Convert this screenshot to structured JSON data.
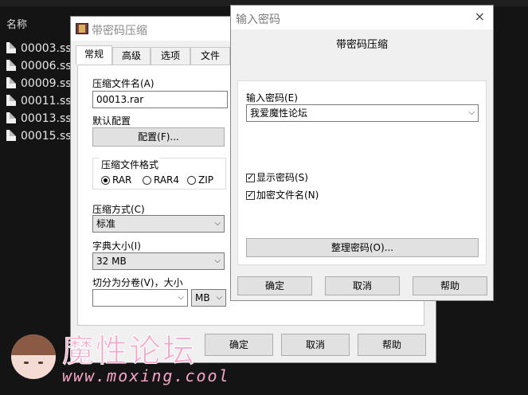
{
  "explorer": {
    "column_header": "名称",
    "files": [
      "00003.ss",
      "00006.ss",
      "00009.ss",
      "00011.ss",
      "00013.ss",
      "00015.ss"
    ]
  },
  "archive_dialog": {
    "title": "带密码压缩",
    "tabs": [
      "常规",
      "高级",
      "选项",
      "文件"
    ],
    "active_tab": "常规",
    "archive_name_label": "压缩文件名(A)",
    "archive_name_value": "00013.rar",
    "default_profile_label": "默认配置",
    "profiles_button": "配置(F)...",
    "format_group_label": "压缩文件格式",
    "formats": [
      "RAR",
      "RAR4",
      "ZIP"
    ],
    "selected_format": "RAR",
    "method_label": "压缩方式(C)",
    "method_value": "标准",
    "dict_label": "字典大小(I)",
    "dict_value": "32 MB",
    "split_label": "切分为分卷(V)，大小",
    "split_value": "",
    "split_unit": "MB",
    "ok_button": "确定",
    "cancel_button": "取消",
    "help_button": "帮助"
  },
  "password_dialog": {
    "title": "输入密码",
    "subtitle": "带密码压缩",
    "password_label": "输入密码(E)",
    "password_value": "我爱魔性论坛",
    "show_password_label": "显示密码(S)",
    "show_password_checked": true,
    "encrypt_names_label": "加密文件名(N)",
    "encrypt_names_checked": true,
    "organize_button": "整理密码(O)...",
    "ok_button": "确定",
    "cancel_button": "取消",
    "help_button": "帮助",
    "close_glyph": "×"
  },
  "watermark": {
    "title": "魔性论坛",
    "url": "www.moxing.cool"
  }
}
